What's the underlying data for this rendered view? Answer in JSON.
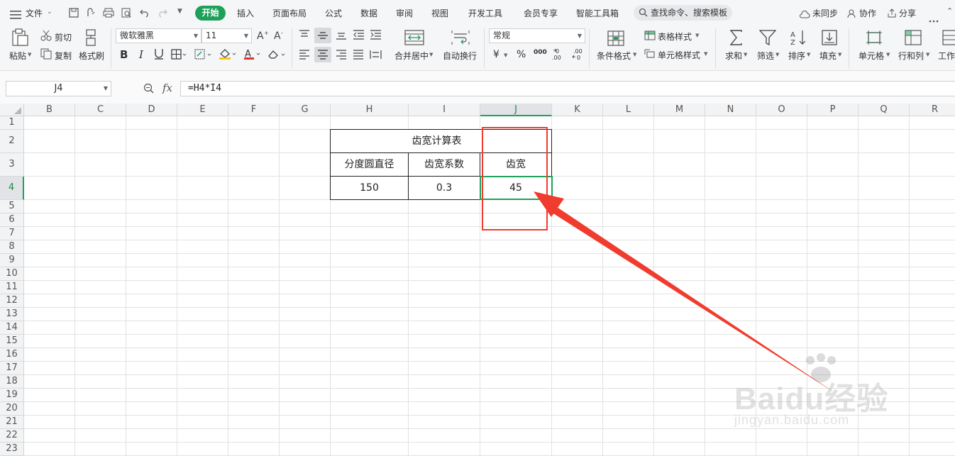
{
  "menubar": {
    "file_label": "文件",
    "tabs": [
      "开始",
      "插入",
      "页面布局",
      "公式",
      "数据",
      "审阅",
      "视图",
      "开发工具",
      "会员专享",
      "智能工具箱"
    ],
    "search_placeholder": "查找命令、搜索模板",
    "sync_label": "未同步",
    "collab_label": "协作",
    "share_label": "分享"
  },
  "ribbon": {
    "paste": "粘贴",
    "cut": "剪切",
    "copy": "复制",
    "format_painter": "格式刷",
    "font_name": "微软雅黑",
    "font_size": "11",
    "merge_center": "合并居中",
    "wrap_text": "自动换行",
    "number_format": "常规",
    "currency": "¥",
    "percent": "%",
    "thousands": "000",
    "conditional_format": "条件格式",
    "table_style": "表格样式",
    "cell_style": "单元格样式",
    "sum": "求和",
    "filter": "筛选",
    "sort": "排序",
    "fill": "填充",
    "cell": "单元格",
    "row_col": "行和列",
    "worksheet": "工作"
  },
  "formula_bar": {
    "name_box": "J4",
    "fx": "fx",
    "formula": "=H4*I4"
  },
  "grid": {
    "columns": [
      "B",
      "C",
      "D",
      "E",
      "F",
      "G",
      "H",
      "I",
      "J",
      "K",
      "L",
      "M",
      "N",
      "O",
      "P",
      "Q",
      "R"
    ],
    "rows": [
      "1",
      "2",
      "3",
      "4",
      "5",
      "6",
      "7",
      "8",
      "9",
      "10",
      "11",
      "12",
      "13",
      "14",
      "15",
      "16",
      "17",
      "18",
      "19",
      "20",
      "21",
      "22",
      "23"
    ],
    "active_column": "J",
    "active_row": "4"
  },
  "table": {
    "title": "齿宽计算表",
    "headers": [
      "分度圆直径",
      "齿宽系数",
      "齿宽"
    ],
    "values": [
      "150",
      "0.3",
      "45"
    ]
  },
  "colors": {
    "accent_green": "#1fa05a",
    "highlight_red": "#f03c2e"
  },
  "watermark": {
    "brand": "Baidu经验",
    "url": "jingyan.baidu.com"
  }
}
